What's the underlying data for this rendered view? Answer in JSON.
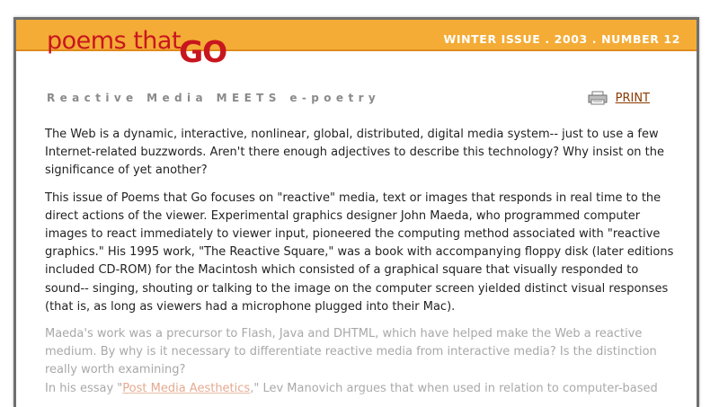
{
  "header": {
    "logo_small": "poems that",
    "logo_big": "GO",
    "issue": "WINTER ISSUE . 2003 . NUMBER 12"
  },
  "article": {
    "subtitle": "Reactive Media MEETS e-poetry",
    "print_label": "PRINT",
    "p1": "The Web is a dynamic, interactive, nonlinear, global, distributed, digital media system-- just to use a few Internet-related buzzwords. Aren't there enough adjectives to describe this technology? Why insist on the significance of yet another?",
    "p2": "This issue of Poems that Go focuses on \"reactive\" media, text or images that responds in real time to the direct actions of the viewer. Experimental graphics designer John Maeda, who programmed computer images to react immediately to viewer input, pioneered the computing method associated with \"reactive graphics.\" His 1995 work, \"The Reactive Square,\" was a book with accompanying floppy disk (later editions included CD-ROM) for the Macintosh which consisted of a graphical square that visually responded to sound-- singing, shouting or talking to the image on the computer screen yielded distinct visual responses (that is, as long as viewers had a microphone plugged into their Mac).",
    "p3": "Maeda's work was a precursor to Flash, Java and DHTML, which have helped make the Web a reactive medium. By why is it necessary to differentiate reactive media from interactive media? Is the distinction really worth examining?",
    "p4_start": "In his essay \"",
    "p4_link": "Post Media Aesthetics",
    "p4_end": ",\" Lev Manovich argues that when used in relation to computer-based"
  },
  "colors": {
    "banner": "#f4ac36",
    "logo": "#c8161e",
    "link": "#8b3a00",
    "frame": "#6f6f6f"
  },
  "icons": {
    "print": "printer-icon"
  }
}
